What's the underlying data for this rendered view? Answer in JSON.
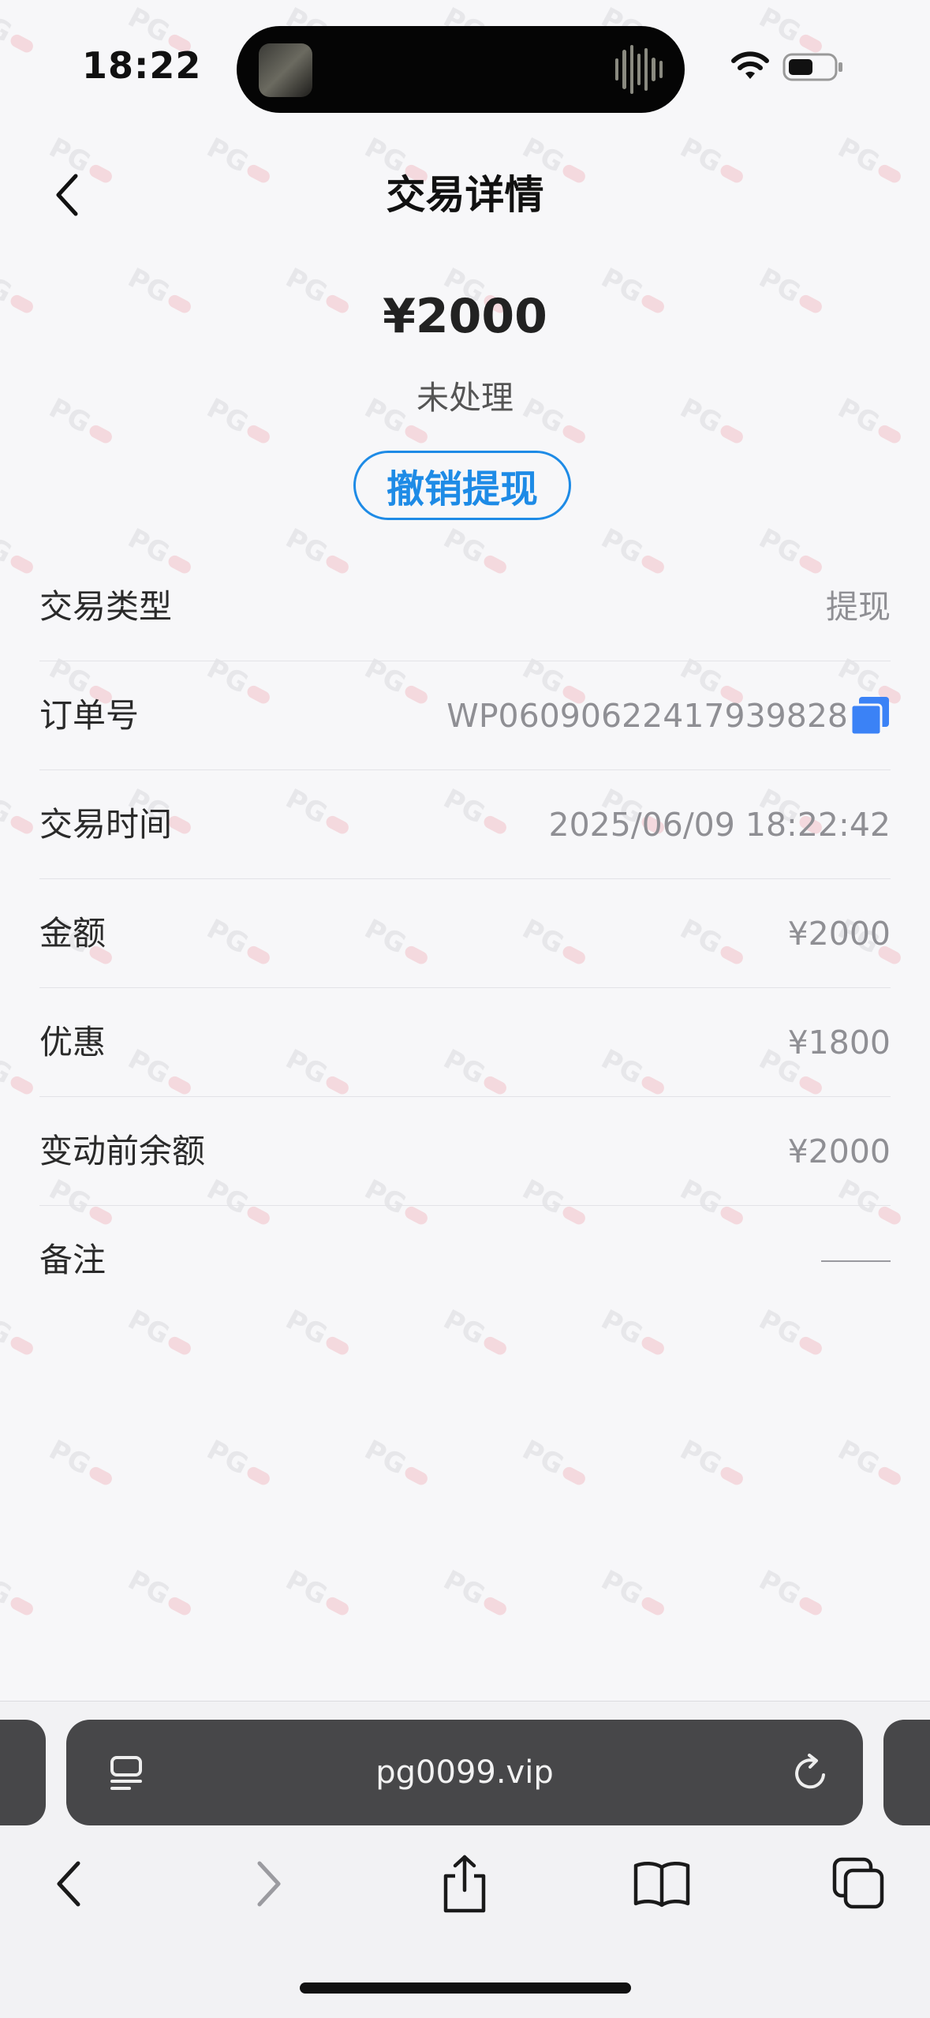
{
  "status_bar": {
    "time": "18:22"
  },
  "header": {
    "title": "交易详情"
  },
  "summary": {
    "amount": "¥2000",
    "status": "未处理",
    "cancel_label": "撤销提现"
  },
  "details": [
    {
      "label": "交易类型",
      "value": "提现"
    },
    {
      "label": "订单号",
      "value": "WP06090622417939828"
    },
    {
      "label": "交易时间",
      "value": "2025/06/09 18:22:42"
    },
    {
      "label": "金额",
      "value": "¥2000"
    },
    {
      "label": "优惠",
      "value": "¥1800"
    },
    {
      "label": "变动前余额",
      "value": "¥2000"
    },
    {
      "label": "备注",
      "value": ""
    }
  ],
  "browser": {
    "url": "pg0099.vip"
  },
  "watermark": "PG",
  "colors": {
    "accent": "#1e8be6",
    "copy_icon": "#3b82f6",
    "url_bar": "#474749"
  }
}
